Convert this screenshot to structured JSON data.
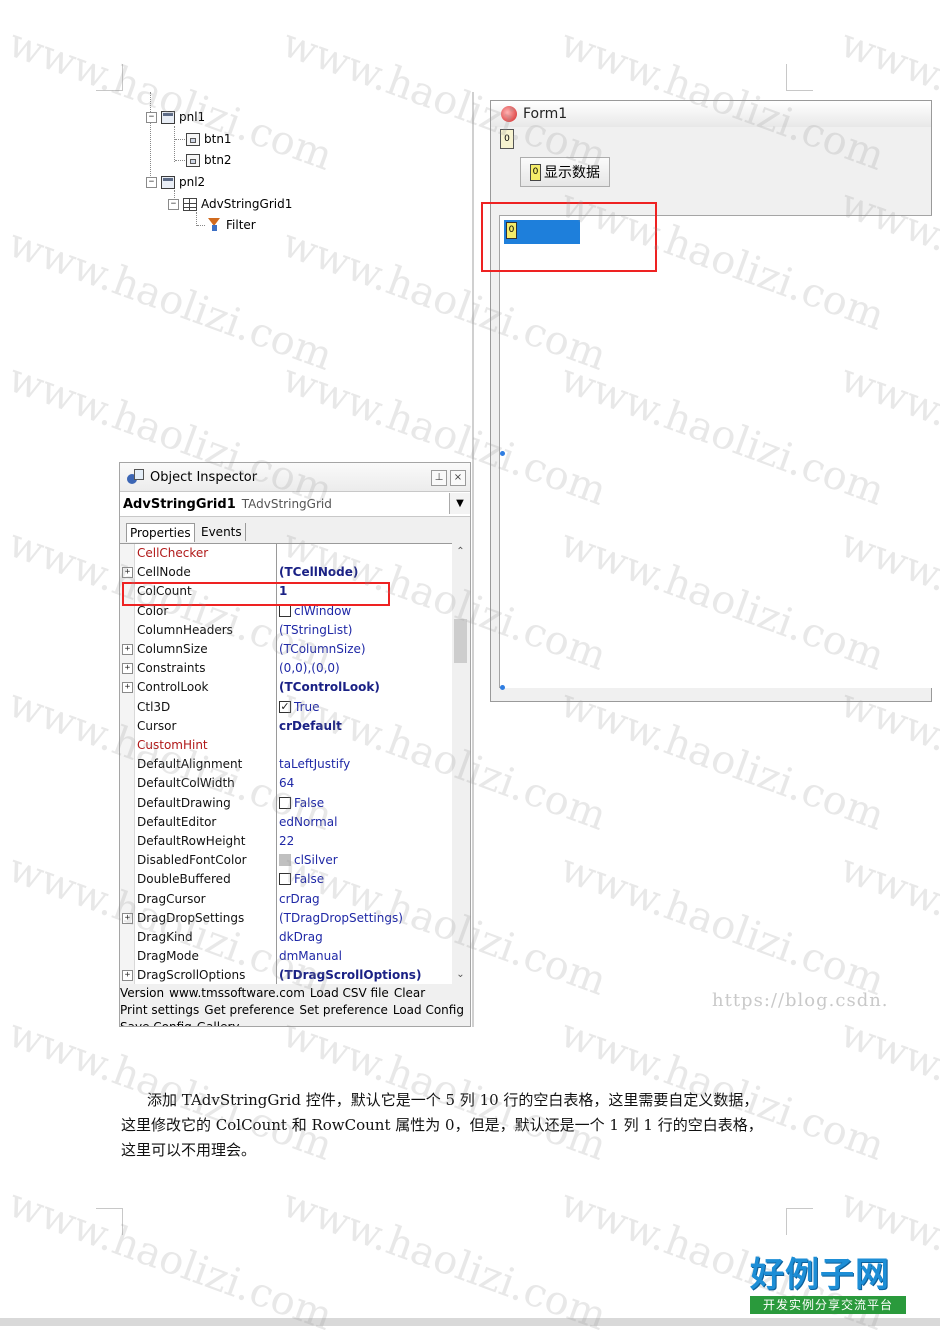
{
  "tree": {
    "nodes": [
      {
        "label": "pnl1",
        "type": "panel"
      },
      {
        "label": "btn1",
        "type": "button"
      },
      {
        "label": "btn2",
        "type": "button"
      },
      {
        "label": "pnl2",
        "type": "panel"
      },
      {
        "label": "AdvStringGrid1",
        "type": "grid"
      },
      {
        "label": "Filter",
        "type": "filter"
      }
    ]
  },
  "form": {
    "title": "Form1",
    "top_marker": "0",
    "button_marker": "0",
    "button_label": "显示数据",
    "grid_marker": "0",
    "selected_cell_color": "#1e7fdb"
  },
  "inspector": {
    "title": "Object Inspector",
    "component_name": "AdvStringGrid1",
    "component_class": "TAdvStringGrid",
    "tab_properties": "Properties",
    "tab_events": "Events",
    "rows": [
      {
        "name": "CellChecker",
        "value": "",
        "event": true
      },
      {
        "name": "CellNode",
        "value": "(TCellNode)",
        "expand": true,
        "bold": true
      },
      {
        "name": "ColCount",
        "value": "1",
        "bold": true
      },
      {
        "name": "Color",
        "value": "clWindow",
        "swatch": "#ffffff"
      },
      {
        "name": "ColumnHeaders",
        "value": "(TStringList)"
      },
      {
        "name": "ColumnSize",
        "value": "(TColumnSize)",
        "expand": true
      },
      {
        "name": "Constraints",
        "value": "(0,0),(0,0)",
        "expand": true
      },
      {
        "name": "ControlLook",
        "value": "(TControlLook)",
        "expand": true,
        "bold": true
      },
      {
        "name": "Ctl3D",
        "value": "True",
        "check": true
      },
      {
        "name": "Cursor",
        "value": "crDefault",
        "bold": true
      },
      {
        "name": "CustomHint",
        "value": "",
        "event": true
      },
      {
        "name": "DefaultAlignment",
        "value": "taLeftJustify"
      },
      {
        "name": "DefaultColWidth",
        "value": "64"
      },
      {
        "name": "DefaultDrawing",
        "value": "False",
        "check": false
      },
      {
        "name": "DefaultEditor",
        "value": "edNormal"
      },
      {
        "name": "DefaultRowHeight",
        "value": "22"
      },
      {
        "name": "DisabledFontColor",
        "value": "clSilver",
        "swatch": "#c0c0c0"
      },
      {
        "name": "DoubleBuffered",
        "value": "False",
        "check": false
      },
      {
        "name": "DragCursor",
        "value": "crDrag"
      },
      {
        "name": "DragDropSettings",
        "value": "(TDragDropSettings)",
        "expand": true
      },
      {
        "name": "DragKind",
        "value": "dkDrag"
      },
      {
        "name": "DragMode",
        "value": "dmManual"
      },
      {
        "name": "DragScrollOptions",
        "value": "(TDragScrollOptions)",
        "expand": true,
        "bold": true
      }
    ],
    "footer_line1": [
      "Version",
      "www.tmssoftware.com",
      "Load CSV file",
      "Clear"
    ],
    "footer_line2": [
      "Print settings",
      "Get preference",
      "Set preference",
      "Load Config"
    ],
    "footer_line3": [
      "Save Config",
      "Gallery"
    ]
  },
  "paragraph": {
    "line1": "添加 TAdvStringGrid 控件，默认它是一个 5 列 10 行的空白表格，这里需要自定义数据，",
    "line2": "这里修改它的 ColCount 和 RowCount 属性为 0，但是，默认还是一个 1 列 1 行的空白表格，",
    "line3": "这里可以不用理会。"
  },
  "watermark_text": "www.haolizi.com",
  "csdn_text": "https://blog.csdn.",
  "logo": {
    "title": "好例子网",
    "subtitle": "开发实例分享交流平台"
  }
}
